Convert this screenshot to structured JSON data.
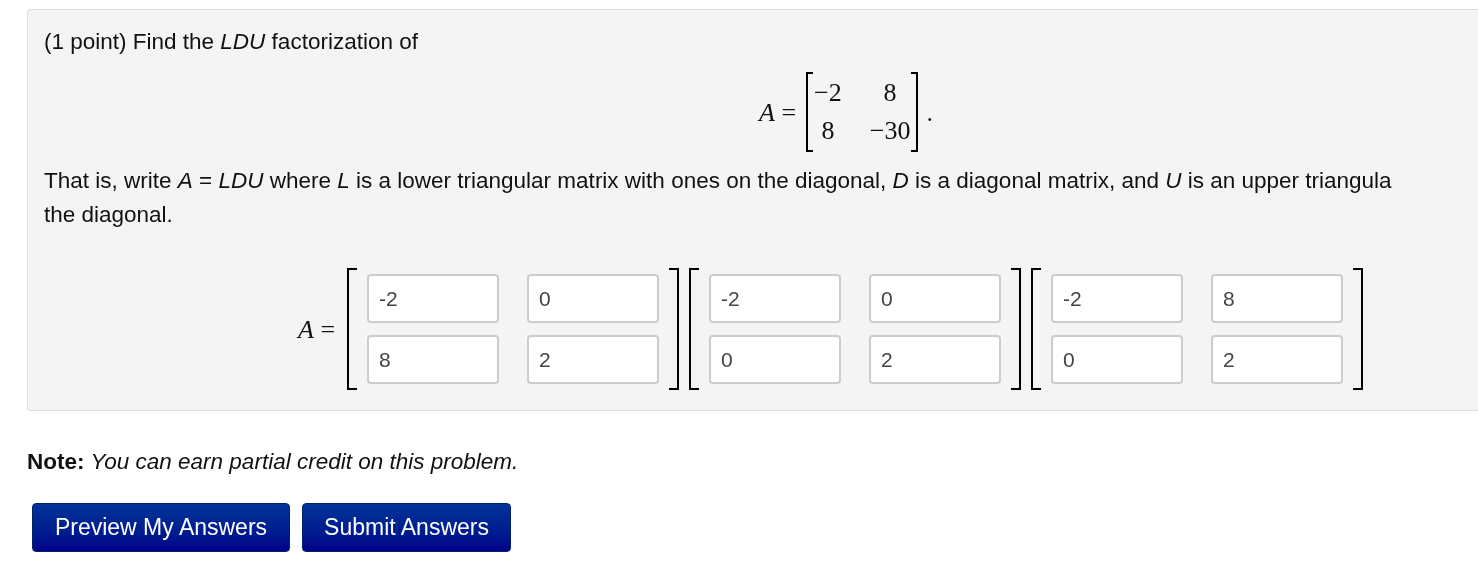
{
  "problem": {
    "intro": "(1 point) Find the *LDU* factorization of",
    "given": {
      "lhs": "*A* =",
      "rows": [
        [
          "−2",
          "8"
        ],
        [
          "8",
          "−30"
        ]
      ],
      "end": "."
    },
    "instructions": [
      "That is, write *A* = *LDU* where *L* is a lower triangular matrix with ones on the diagonal, *D* is a diagonal matrix, and *U* is an upper triangula",
      "the diagonal."
    ],
    "answer": {
      "lhs": "*A* =",
      "matrices": [
        {
          "rows": [
            [
              "-2",
              "0"
            ],
            [
              "8",
              "2"
            ]
          ]
        },
        {
          "rows": [
            [
              "-2",
              "0"
            ],
            [
              "0",
              "2"
            ]
          ]
        },
        {
          "rows": [
            [
              "-2",
              "8"
            ],
            [
              "0",
              "2"
            ]
          ]
        }
      ]
    }
  },
  "note": {
    "label": "Note:",
    "text": "You can earn partial credit on this problem."
  },
  "buttons": [
    "Preview My Answers",
    "Submit Answers"
  ]
}
